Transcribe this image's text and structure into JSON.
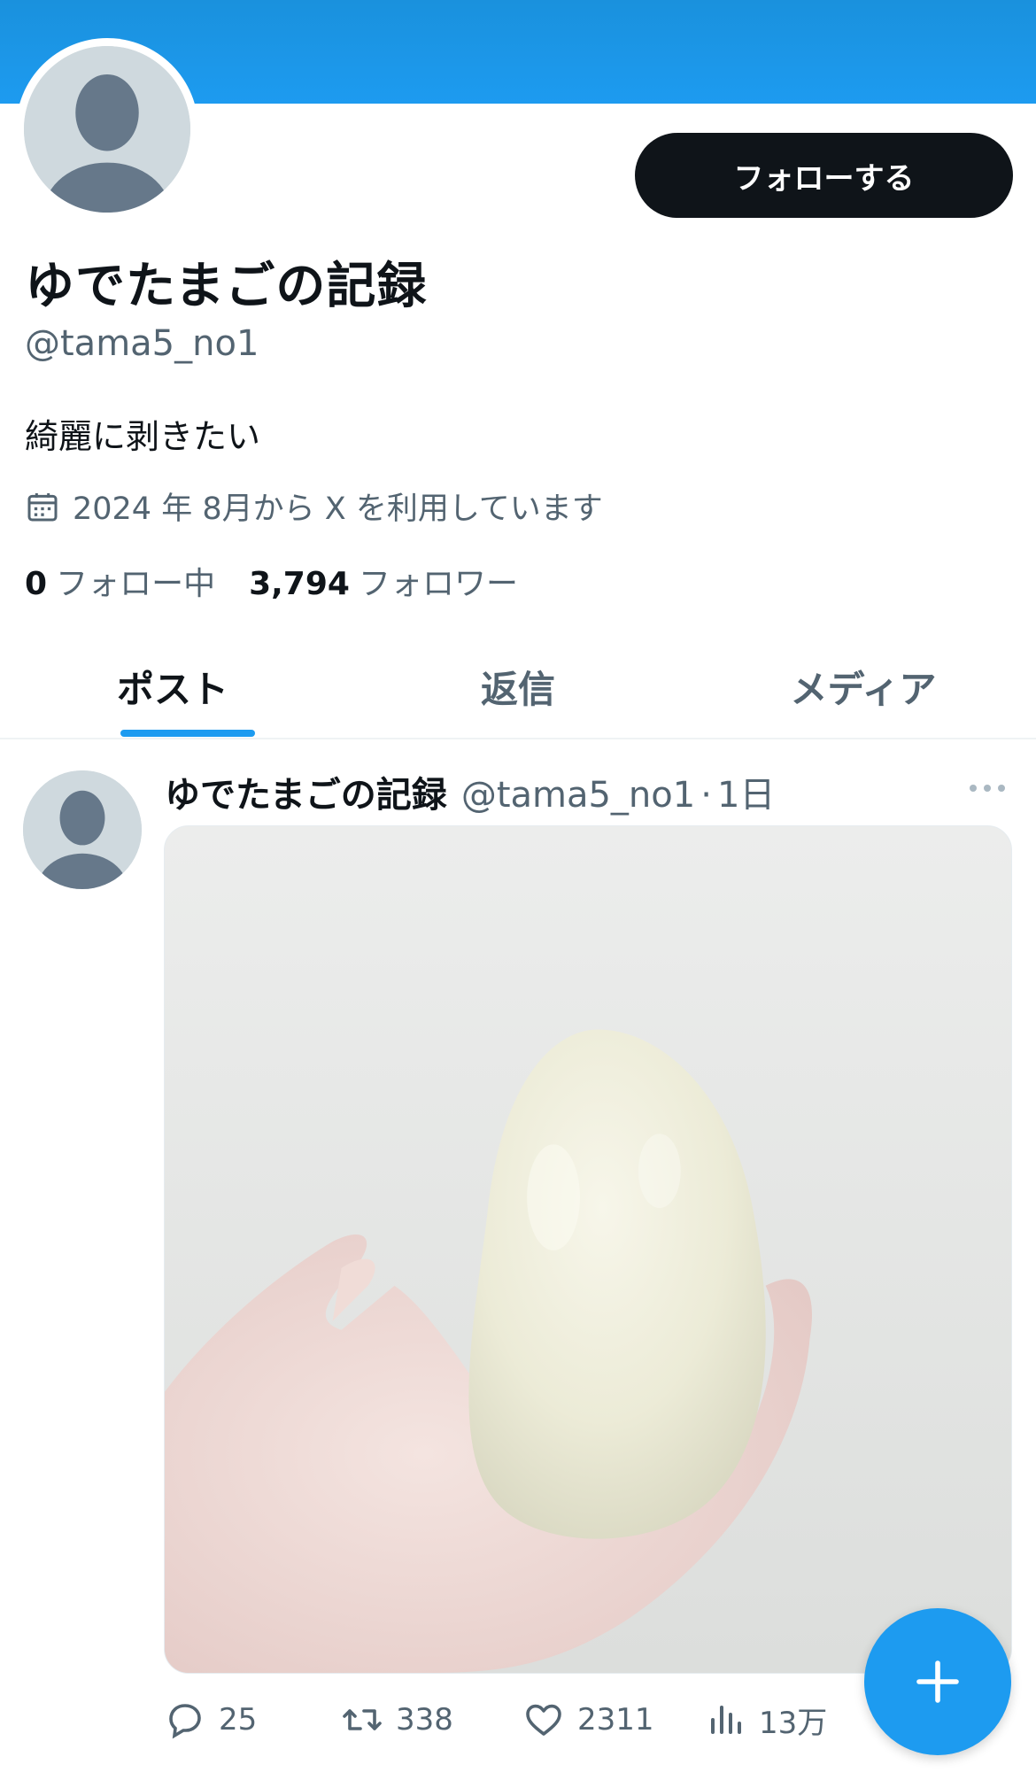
{
  "profile": {
    "display_name": "ゆでたまごの記録",
    "handle": "@tama5_no1",
    "bio": "綺麗に剥きたい",
    "joined": "2024 年 8月から X を利用しています",
    "follow_button": "フォローする",
    "following_count": "0",
    "following_label": "フォロー中",
    "followers_count": "3,794",
    "followers_label": "フォロワー"
  },
  "tabs": [
    {
      "label": "ポスト",
      "active": true
    },
    {
      "label": "返信",
      "active": false
    },
    {
      "label": "メディア",
      "active": false
    }
  ],
  "tweet": {
    "author_name": "ゆでたまごの記録",
    "author_handle": "@tama5_no1",
    "separator": "·",
    "time": "1日",
    "media_description_icon": "peeled-boiled-egg-photo",
    "replies": "25",
    "retweets": "338",
    "likes": "2311",
    "views": "13万"
  },
  "colors": {
    "accent": "#1d9bf0",
    "text_primary": "#0f1419",
    "text_secondary": "#536471",
    "follow_button_bg": "#0f1419"
  },
  "icons": {
    "calendar": "calendar-icon",
    "more": "more-horizontal-icon",
    "reply": "reply-icon",
    "retweet": "retweet-icon",
    "like": "heart-icon",
    "views": "views-bar-chart-icon",
    "compose": "plus-icon"
  }
}
